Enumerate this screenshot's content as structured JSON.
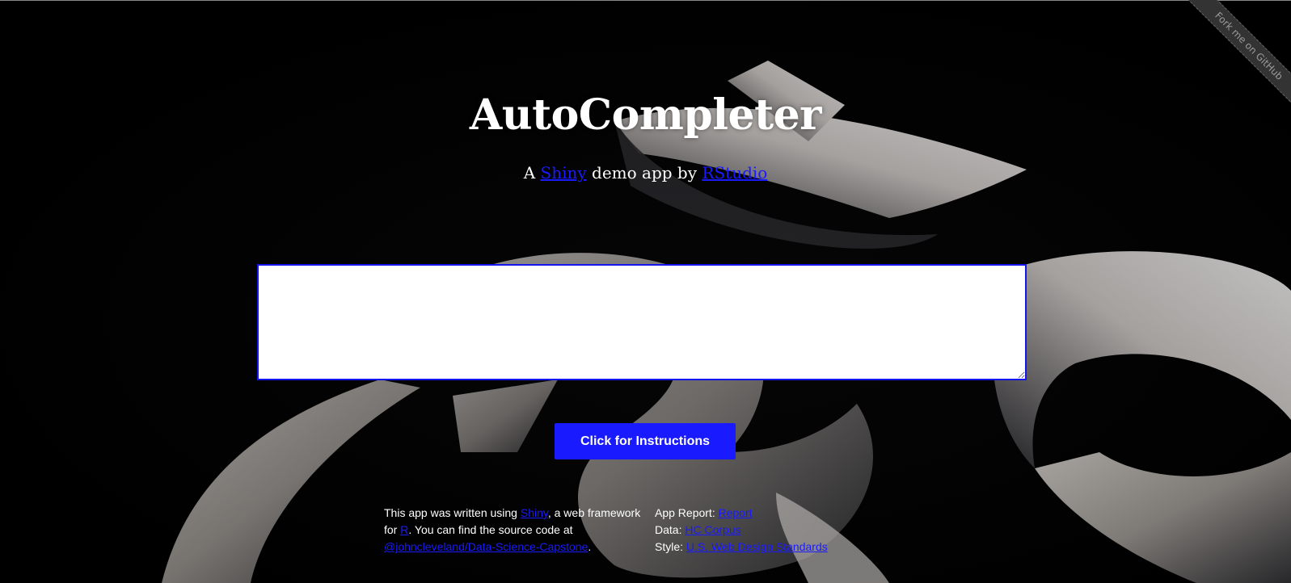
{
  "ribbon": {
    "text": "Fork me on GitHub"
  },
  "header": {
    "title": "AutoCompleter",
    "subtitle_prefix": "A ",
    "subtitle_link1": "Shiny",
    "subtitle_middle": " demo app by ",
    "subtitle_link2": "RStudio"
  },
  "input": {
    "value": "",
    "placeholder": ""
  },
  "button": {
    "label": "Click for Instructions"
  },
  "footer": {
    "left": {
      "t1": "This app was written using ",
      "link_shiny": "Shiny",
      "t2": ", a web framework for ",
      "link_r": "R",
      "t3": ". You can find the source code at ",
      "link_repo": "@johncleveland/Data-Science-Capstone",
      "t4": "."
    },
    "right": {
      "report_label": "App Report: ",
      "report_link": "Report",
      "data_label": "Data: ",
      "data_link": "HC Corpus",
      "style_label": "Style: ",
      "style_link": "U.S. Web Design Standards"
    }
  },
  "colors": {
    "accent": "#1a1aff",
    "background": "#000000",
    "text": "#ffffff"
  }
}
